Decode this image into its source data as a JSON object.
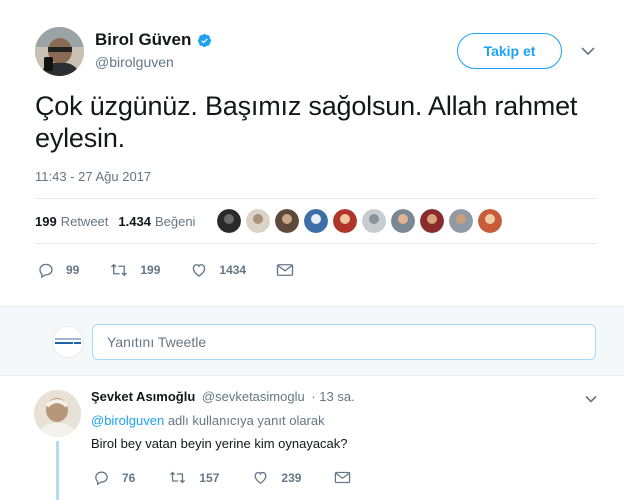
{
  "tweet": {
    "author_name": "Birol Güven",
    "author_handle": "@birolguven",
    "follow_label": "Takip et",
    "text": "Çok üzgünüz. Başımız sağolsun. Allah rahmet eylesin.",
    "timestamp": "11:43 - 27 Ağu 2017",
    "retweet_count": "199",
    "retweet_label": "Retweet",
    "like_count": "1.434",
    "like_label": "Beğeni",
    "actions": {
      "replies": "99",
      "retweets": "199",
      "likes": "1434"
    }
  },
  "reply_box": {
    "placeholder": "Yanıtını Tweetle"
  },
  "reply": {
    "author_name": "Şevket Asımoğlu",
    "author_handle": "@sevketasimoglu",
    "time": "· 13 sa.",
    "mention": "@birolguven",
    "context_suffix": "adlı kullanıcıya yanıt olarak",
    "text": "Birol bey vatan beyin yerine kim oynayacak?",
    "actions": {
      "replies": "76",
      "retweets": "157",
      "likes": "239"
    }
  },
  "colors": {
    "accent": "#1da1f2",
    "muted": "#657786",
    "text": "#14171a",
    "border": "#e6ecf0",
    "reply_bg": "#f5f8fa"
  },
  "icons": {
    "verified": "verified-badge-icon",
    "caret": "chevron-down-icon",
    "reply": "reply-icon",
    "retweet": "retweet-icon",
    "like": "heart-icon",
    "message": "envelope-icon"
  }
}
